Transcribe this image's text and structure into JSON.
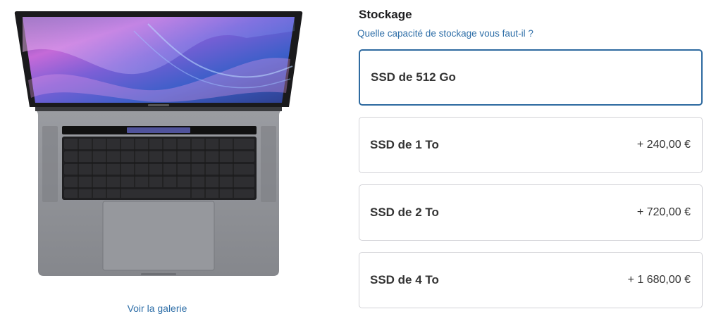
{
  "gallery": {
    "link_label": "Voir la galerie"
  },
  "storage": {
    "title": "Stockage",
    "help_link": "Quelle capacité de stockage vous faut-il ?",
    "options": [
      {
        "label": "SSD de 512 Go",
        "price": "",
        "selected": true
      },
      {
        "label": "SSD de 1 To",
        "price": "+ 240,00 €",
        "selected": false
      },
      {
        "label": "SSD de 2 To",
        "price": "+ 720,00 €",
        "selected": false
      },
      {
        "label": "SSD de 4 To",
        "price": "+ 1 680,00 €",
        "selected": false
      }
    ]
  },
  "colors": {
    "link": "#2f6fa8",
    "selected_border": "#2e6aa0",
    "card_border": "#d2d2d7",
    "laptop_body": "#8f9196"
  }
}
